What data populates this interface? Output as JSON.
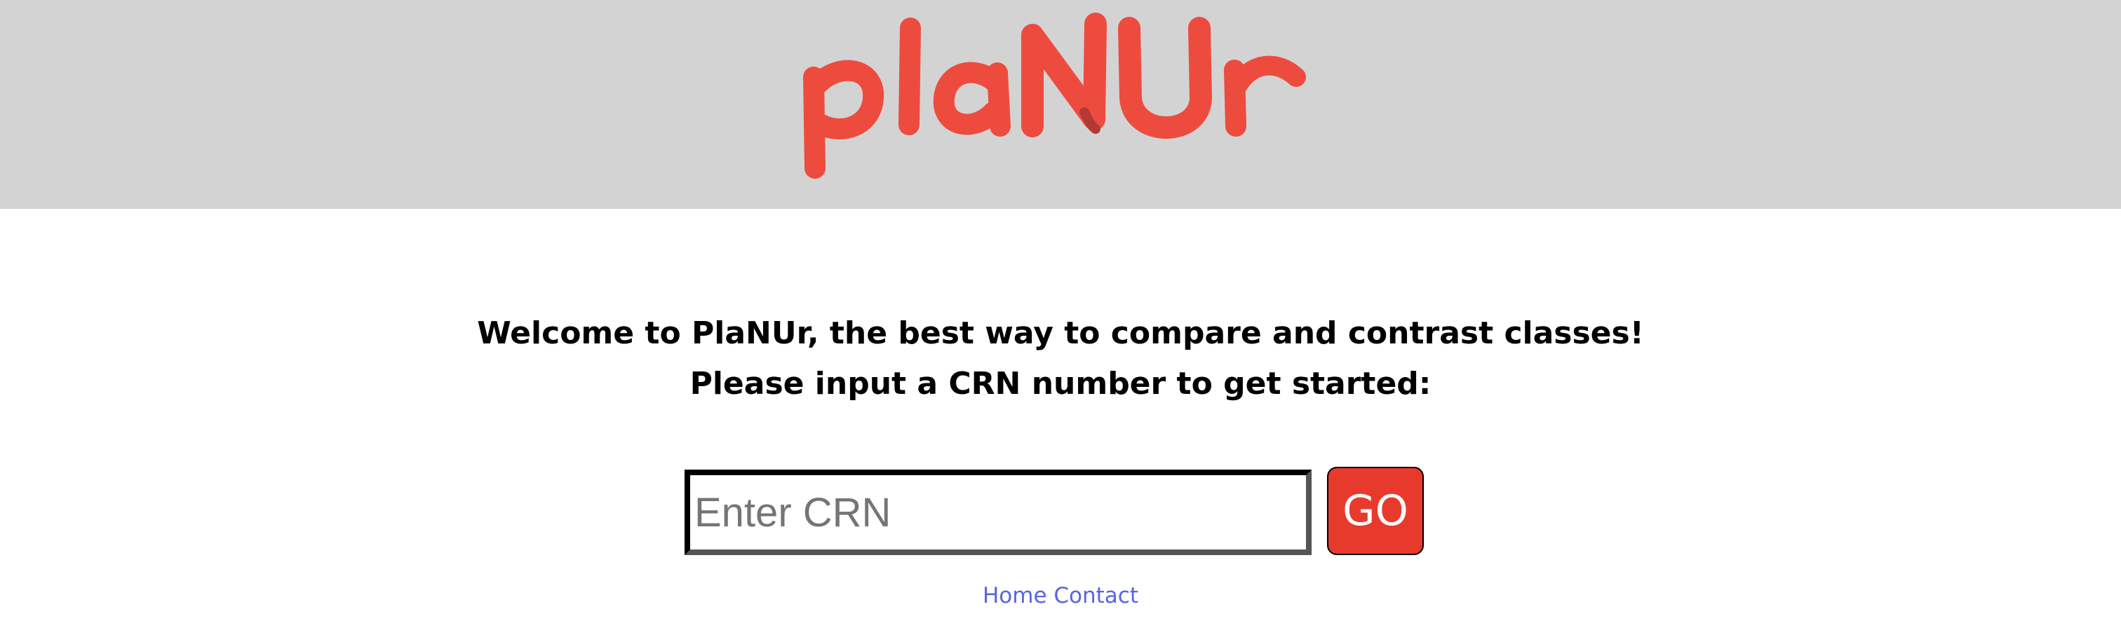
{
  "header": {
    "logo_text": "plaNUr",
    "background_color": "#d3d3d3",
    "logo_color": "#ee4b3f"
  },
  "main": {
    "welcome_line_1": "Welcome to PlaNUr, the best way to compare and contrast classes!",
    "welcome_line_2": "Please input a CRN number to get started:"
  },
  "search": {
    "value": "",
    "placeholder": "Enter CRN"
  },
  "go_button": {
    "label": "GO",
    "color": "#e83a2c"
  },
  "nav": {
    "home_label": "Home",
    "contact_label": "Contact",
    "link_color": "#5865e0"
  }
}
